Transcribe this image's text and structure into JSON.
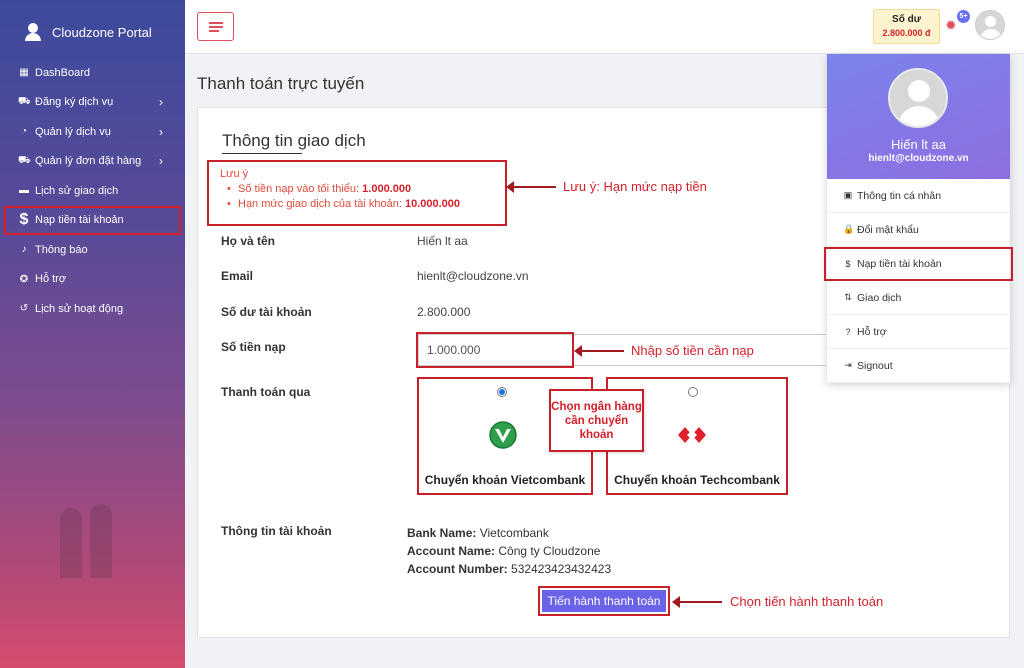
{
  "sidebar": {
    "brand": "Cloudzone Portal",
    "items": [
      {
        "label": "DashBoard",
        "icon": "dashboard-icon",
        "glyph": "▦",
        "chevron": false
      },
      {
        "label": "Đăng ký dịch vụ",
        "icon": "cart-icon",
        "glyph": "⛟",
        "chevron": true
      },
      {
        "label": "Quản lý dịch vụ",
        "icon": "gauge-icon",
        "glyph": "◔",
        "chevron": true
      },
      {
        "label": "Quản lý đơn đặt hàng",
        "icon": "shopping-cart-icon",
        "glyph": "⛟",
        "chevron": true
      },
      {
        "label": "Lịch sử giao dịch",
        "icon": "card-icon",
        "glyph": "▬",
        "chevron": false
      },
      {
        "label": "Nạp tiền tài khoản",
        "icon": "dollar-icon",
        "glyph": "$",
        "chevron": false,
        "active": true
      },
      {
        "label": "Thông báo",
        "icon": "bell-icon",
        "glyph": "♪",
        "chevron": false
      },
      {
        "label": "Hỗ trợ",
        "icon": "support-icon",
        "glyph": "✪",
        "chevron": false
      },
      {
        "label": "Lịch sử hoạt động",
        "icon": "history-icon",
        "glyph": "↺",
        "chevron": false
      }
    ]
  },
  "header": {
    "balance_label": "Số dư",
    "balance_value": "2.800.000 đ",
    "notification_count": "5+"
  },
  "page_title": "Thanh toán trực tuyến",
  "card_title": "Thông tin giao dịch",
  "note": {
    "title": "Lưu ý",
    "min_label": "Số tiền nạp vào tối thiểu: ",
    "min_value": "1.000.000",
    "limit_label": "Hạn mức giao dịch của tài khoản: ",
    "limit_value": "10.000.000"
  },
  "form": {
    "name_label": "Họ và tên",
    "name_value": "Hiến lt aa",
    "email_label": "Email",
    "email_value": "hienlt@cloudzone.vn",
    "balance_label": "Số dư tài khoản",
    "balance_value": "2.800.000",
    "amount_label": "Số tiền nạp",
    "amount_value": "1.000.000",
    "pay_via_label": "Thanh toán qua",
    "account_info_label": "Thông tin tài khoản"
  },
  "banks": [
    {
      "name": "Chuyển khoản Vietcombank",
      "selected": true
    },
    {
      "name": "Chuyển khoản Techcombank",
      "selected": false
    }
  ],
  "account_info": {
    "bank_name_label": "Bank Name:",
    "bank_name": "Vietcombank",
    "account_name_label": "Account Name:",
    "account_name": "Công ty Cloudzone",
    "account_number_label": "Account Number:",
    "account_number": "532423423432423"
  },
  "pay_button": "Tiến hành thanh toán",
  "annotations": {
    "limit": "Lưu ý: Hạn mức nạp tiền",
    "amount": "Nhập số tiền cần nạp",
    "choose_bank": "Chọn ngân hàng cần chuyển khoản",
    "pay": "Chọn tiến hành thanh toán"
  },
  "dropdown": {
    "name": "Hiến lt aa",
    "email": "hienlt@cloudzone.vn",
    "items": [
      {
        "label": "Thông tin cá nhân",
        "icon": "id-card-icon",
        "glyph": "▣"
      },
      {
        "label": "Đổi mật khẩu",
        "icon": "lock-icon",
        "glyph": "🔒"
      },
      {
        "label": "Nạp tiền tài khoản",
        "icon": "dollar-icon",
        "glyph": "$",
        "highlight": true
      },
      {
        "label": "Giao dịch",
        "icon": "exchange-icon",
        "glyph": "⇅"
      },
      {
        "label": "Hỗ trợ",
        "icon": "help-icon",
        "glyph": "?"
      },
      {
        "label": "Signout",
        "icon": "signout-icon",
        "glyph": "⇥"
      }
    ]
  },
  "colors": {
    "accent_red": "#d4202a",
    "button_purple": "#6a63e8",
    "sidebar_top": "#3d4a9c",
    "sidebar_bottom": "#d64c6e"
  }
}
